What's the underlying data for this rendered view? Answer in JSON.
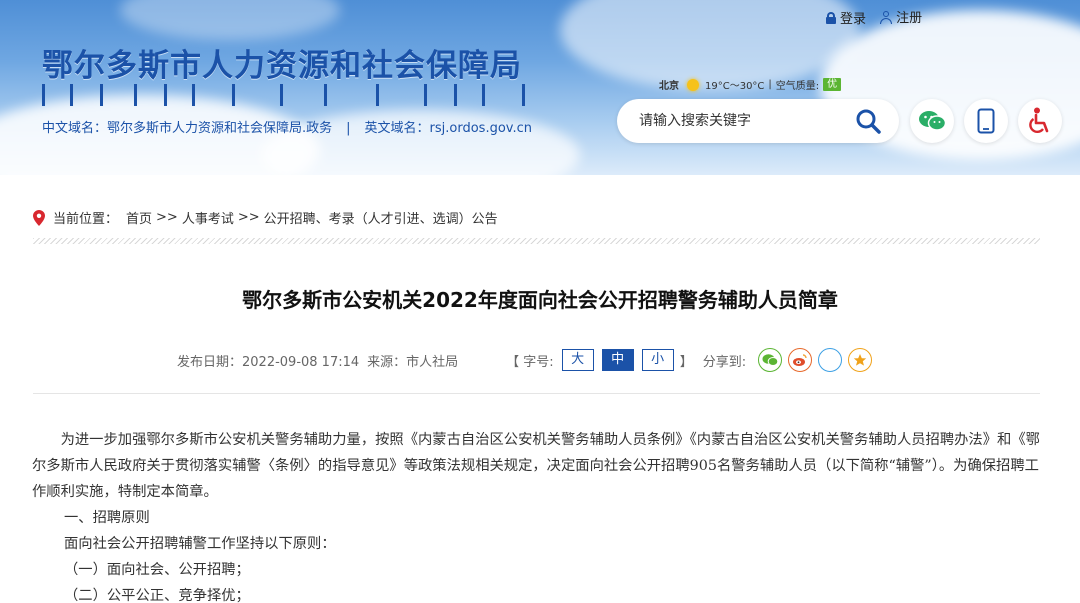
{
  "header": {
    "site_title": "鄂尔多斯市人力资源和社会保障局",
    "cn_domain": "中文域名：鄂尔多斯市人力资源和社会保障局.政务",
    "separator": "|",
    "en_domain": "英文域名：rsj.ordos.gov.cn",
    "login_label": "登录",
    "register_label": "注册",
    "weather": {
      "city": "北京",
      "temperature": "19°C～30°C",
      "divider": "|",
      "air_quality_label": "空气质量:",
      "air_quality_value": "优"
    },
    "search": {
      "placeholder": "请输入搜索关键字"
    },
    "icons": [
      "wechat-icon",
      "mobile-icon",
      "accessibility-icon"
    ],
    "colors": {
      "brand": "#1b52a8",
      "wechat": "#2aae67",
      "accessibility": "#d8282f",
      "air_good": "#5bb533"
    }
  },
  "breadcrumb": {
    "prefix": "当前位置：",
    "items": [
      "首页",
      "人事考试",
      "公开招聘、考录（人才引进、选调）公告"
    ],
    "arrow": ">>"
  },
  "article": {
    "title": "鄂尔多斯市公安机关2022年度面向社会公开招聘警务辅助人员简章",
    "publish_date": "发布日期：2022-09-08 17:14",
    "source": "来源：市人社局",
    "font_size_label": "【 字号:",
    "font_sizes": [
      "大",
      "中",
      "小"
    ],
    "active_font_size": "中",
    "bracket_close": "】",
    "share_label": "分享到:",
    "share_icons": [
      "wechat-share-icon",
      "weibo-share-icon",
      "qzone-share-icon",
      "favorite-share-icon"
    ],
    "paragraphs": [
      "为进一步加强鄂尔多斯市公安机关警务辅助力量，按照《内蒙古自治区公安机关警务辅助人员条例》《内蒙古自治区公安机关警务辅助人员招聘办法》和《鄂尔多斯市人民政府关于贯彻落实辅警〈条例〉的指导意见》等政策法规相关规定，决定面向社会公开招聘905名警务辅助人员（以下简称“辅警”）。为确保招聘工作顺利实施，特制定本简章。",
      "一、招聘原则",
      "面向社会公开招聘辅警工作坚持以下原则：",
      "（一）面向社会、公开招聘；",
      "（二）公平公正、竞争择优；"
    ]
  }
}
